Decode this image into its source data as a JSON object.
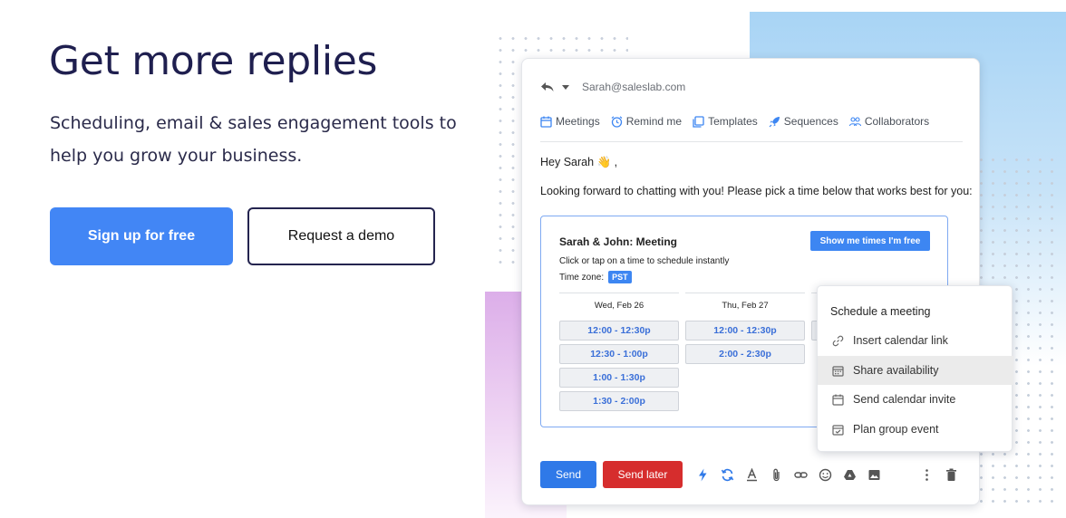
{
  "hero": {
    "title": "Get more replies",
    "subtitle_line1": "Scheduling, email & sales engagement tools to",
    "subtitle_line2": "help you grow your business.",
    "primary_cta": "Sign up for free",
    "secondary_cta": "Request a demo"
  },
  "email": {
    "from": "Sarah@saleslab.com",
    "toolbar": [
      {
        "label": "Meetings",
        "icon": "calendar-icon"
      },
      {
        "label": "Remind me",
        "icon": "alarm-clock-icon"
      },
      {
        "label": "Templates",
        "icon": "templates-icon"
      },
      {
        "label": "Sequences",
        "icon": "rocket-icon"
      },
      {
        "label": "Collaborators",
        "icon": "people-icon"
      }
    ],
    "greeting": "Hey Sarah 👋 ,",
    "body": "Looking forward to chatting with you! Please pick a time below that works best for you:",
    "meeting": {
      "title": "Sarah & John: Meeting",
      "show_button": "Show me times I'm free",
      "hint": "Click or tap on a time to schedule instantly",
      "timezone_label": "Time zone:",
      "timezone": "PST",
      "days": [
        {
          "date": "Wed, Feb 26",
          "slots": [
            "12:00 - 12:30p",
            "12:30 - 1:00p",
            "1:00 - 1:30p",
            "1:30 - 2:00p"
          ]
        },
        {
          "date": "Thu, Feb 27",
          "slots": [
            "12:00 - 12:30p",
            "2:00 - 2:30p"
          ]
        }
      ]
    },
    "send_label": "Send",
    "send_later_label": "Send later",
    "colors": {
      "send": "#2f79e8",
      "send_later": "#d62d2d",
      "accent": "#3d86f2"
    }
  },
  "menu": {
    "title": "Schedule a meeting",
    "items": [
      {
        "label": "Insert calendar link",
        "icon": "link-icon"
      },
      {
        "label": "Share availability",
        "icon": "calendar-grid-icon",
        "active": true
      },
      {
        "label": "Send calendar invite",
        "icon": "calendar-icon"
      },
      {
        "label": "Plan group event",
        "icon": "calendar-check-icon"
      }
    ]
  }
}
